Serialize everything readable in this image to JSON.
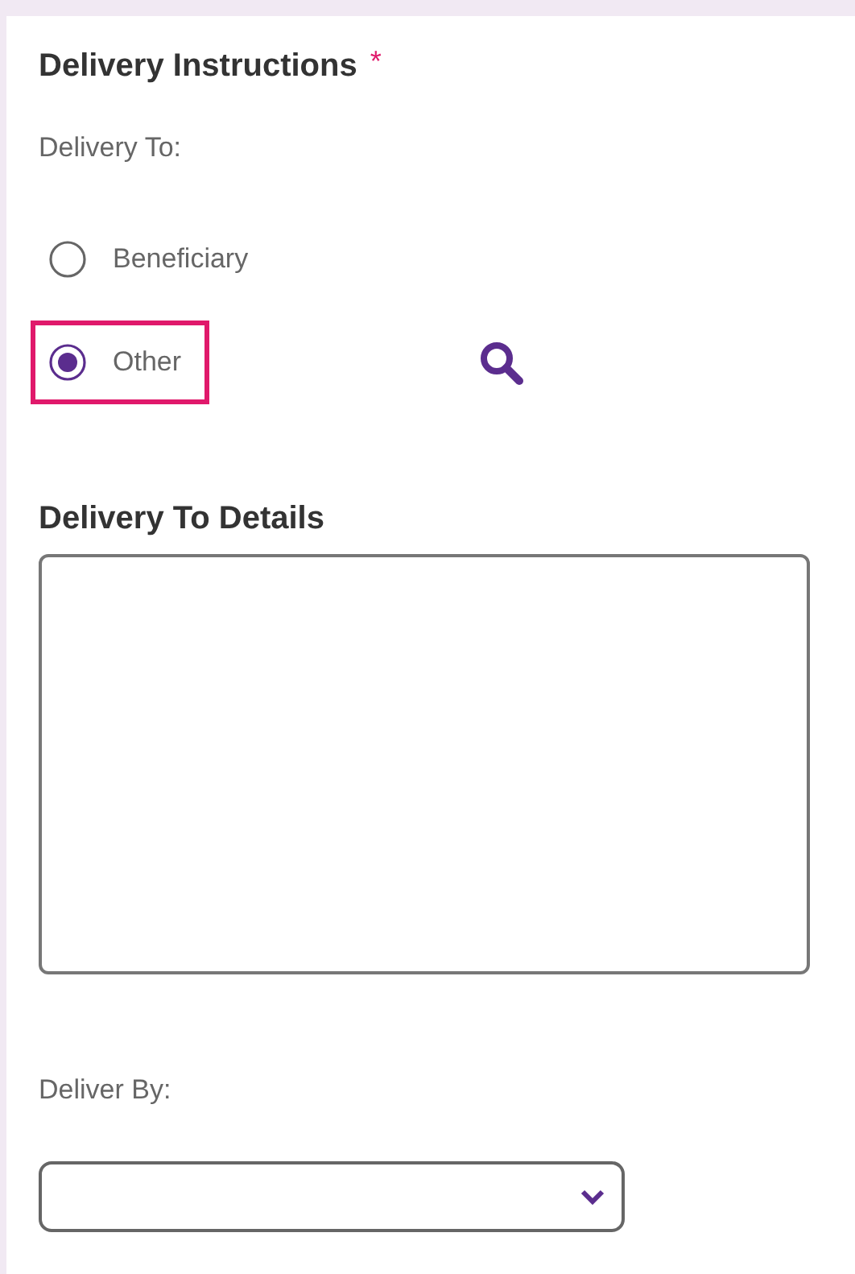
{
  "section": {
    "title": "Delivery Instructions",
    "required_mark": "*"
  },
  "delivery_to": {
    "label": "Delivery To:",
    "options": [
      {
        "label": "Beneficiary",
        "selected": false,
        "highlighted": false
      },
      {
        "label": "Other",
        "selected": true,
        "highlighted": true
      }
    ]
  },
  "details": {
    "title": "Delivery To Details"
  },
  "deliver_by": {
    "label": "Deliver By:"
  }
}
